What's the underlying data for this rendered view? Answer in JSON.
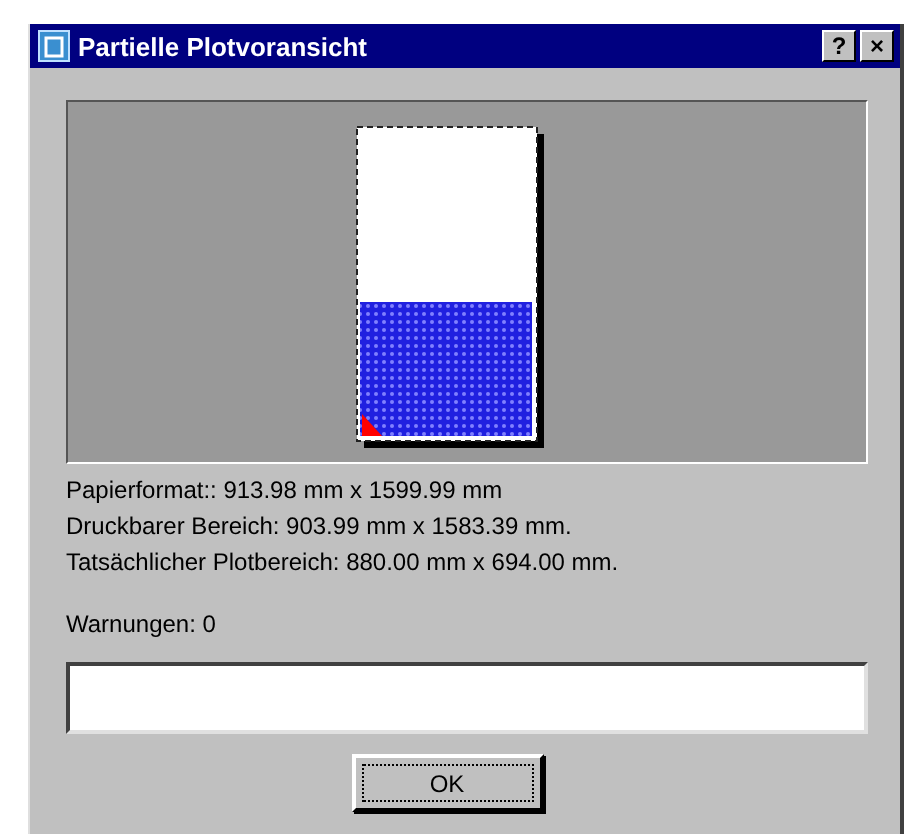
{
  "window": {
    "title": "Partielle Plotvoransicht",
    "title_buttons": [
      "?",
      "×"
    ]
  },
  "info_lines": [
    "Papierformat::  913.98 mm x 1599.99 mm",
    "Druckbarer Bereich:  903.99 mm x 1583.39 mm.",
    "Tatsächlicher Plotbereich:  880.00 mm x 694.00 mm."
  ],
  "warnings": {
    "label": "Warnungen:  0"
  },
  "buttons": [
    {
      "label": "OK",
      "focused": true
    }
  ]
}
